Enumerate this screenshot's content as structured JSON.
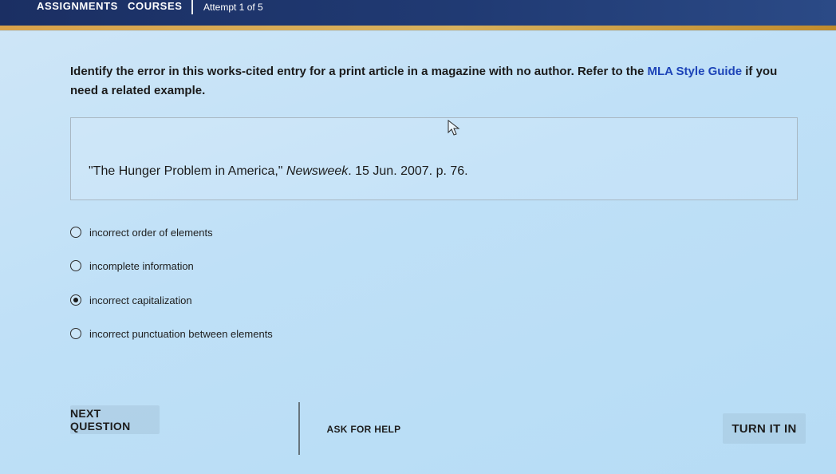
{
  "top_nav": {
    "assignments_label": "ASSIGNMENTS",
    "courses_label": "COURSES",
    "attempt_text": "Attempt 1 of 5",
    "bar_color": "#203a73",
    "accent_color": "#d7b15e"
  },
  "question": {
    "prefix": "Identify the error in this works-cited entry for a print article in a magazine with no author. Refer to the ",
    "link_text": "MLA Style Guide",
    "suffix": " if you need a related example.",
    "link_color": "#1d44b8"
  },
  "citation": {
    "part1": "\"The Hunger Problem in America,\" ",
    "magazine": "Newsweek",
    "part2": ". 15 Jun. 2007. p. 76."
  },
  "options": {
    "items": [
      {
        "label": "incorrect order of elements",
        "selected": false
      },
      {
        "label": "incomplete information",
        "selected": false
      },
      {
        "label": "incorrect capitalization",
        "selected": true
      },
      {
        "label": "incorrect punctuation between elements",
        "selected": false
      }
    ]
  },
  "buttons": {
    "next_question": "NEXT QUESTION",
    "ask_for_help": "ASK FOR HELP",
    "turn_it_in": "TURN IT IN"
  }
}
